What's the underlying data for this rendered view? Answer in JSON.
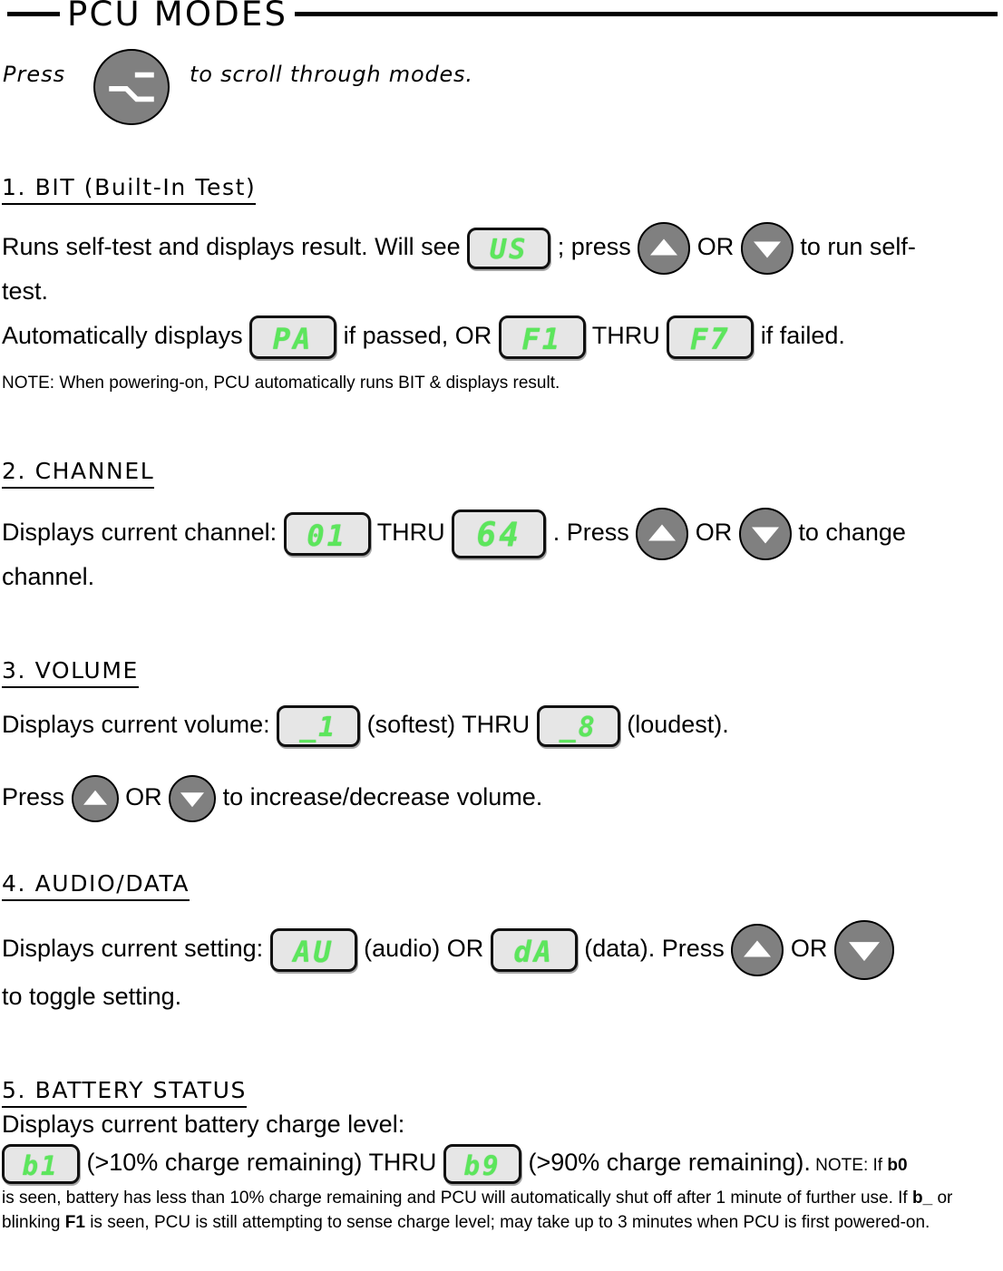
{
  "document": {
    "title": "PCU  MODES",
    "intro": {
      "press_label": "Press",
      "tail": "to scroll through modes.",
      "button_icon": "scroll-mode-button"
    }
  },
  "sections": [
    {
      "heading": "1. BIT  (Built-In Test)",
      "line1_a": "Runs self-test and displays result. Will see",
      "lcd_us": "US",
      "line1_b": "; press",
      "or": "OR",
      "line1_c": "to run self-",
      "line2": "test.",
      "line3_a": "Automatically displays",
      "lcd_pa": "PA",
      "line3_b": "if passed, OR",
      "lcd_f1": "F1",
      "line3_c": "THRU",
      "lcd_f7": "F7",
      "line3_d": "if failed.",
      "note": "NOTE: When powering-on, PCU automatically runs BIT & displays result."
    },
    {
      "heading": "2. CHANNEL",
      "line1_a": "Displays current channel:",
      "lcd_01": "01",
      "line1_b": "THRU",
      "lcd_64": "64",
      "line1_c": ".   Press",
      "or": "OR",
      "line1_d": "to change",
      "line2": "channel."
    },
    {
      "heading": "3. VOLUME",
      "line1_a": "Displays current volume:",
      "lcd_min": "_1",
      "line1_b": "(softest) THRU",
      "lcd_max": "_8",
      "line1_c": "(loudest).",
      "line2_a": "Press",
      "or": "OR",
      "line2_b": "to increase/decrease volume."
    },
    {
      "heading": "4. AUDIO/DATA",
      "line1_a": "Displays current setting:",
      "lcd_au": "AU",
      "line1_b": "(audio)  OR",
      "lcd_da": "dA",
      "line1_c": "(data).  Press",
      "or": "OR",
      "line2": "to toggle setting."
    },
    {
      "heading": "5. BATTERY STATUS",
      "line1": "Displays current battery charge level:",
      "lcd_b1": "b1",
      "line2_a": "(>10% charge remaining) THRU",
      "lcd_b9": "b9",
      "line2_b": "(>90% charge remaining).",
      "note_lead": "NOTE: If",
      "note_b0": "b0",
      "note_part2": "is seen, battery has less than 10% charge remaining and PCU will automatically shut off after 1 minute of further use. If",
      "note_b_": "b_",
      "note_part3": "or blinking",
      "note_f1": "F1",
      "note_part4": "is seen, PCU is still attempting to sense charge level; may take up to 3 minutes when PCU is first powered-on."
    }
  ],
  "colors": {
    "lcd_green": "#5ce65c",
    "lcd_background": "#e6e6e6",
    "button_gray": "#808080",
    "outline": "#000000"
  }
}
